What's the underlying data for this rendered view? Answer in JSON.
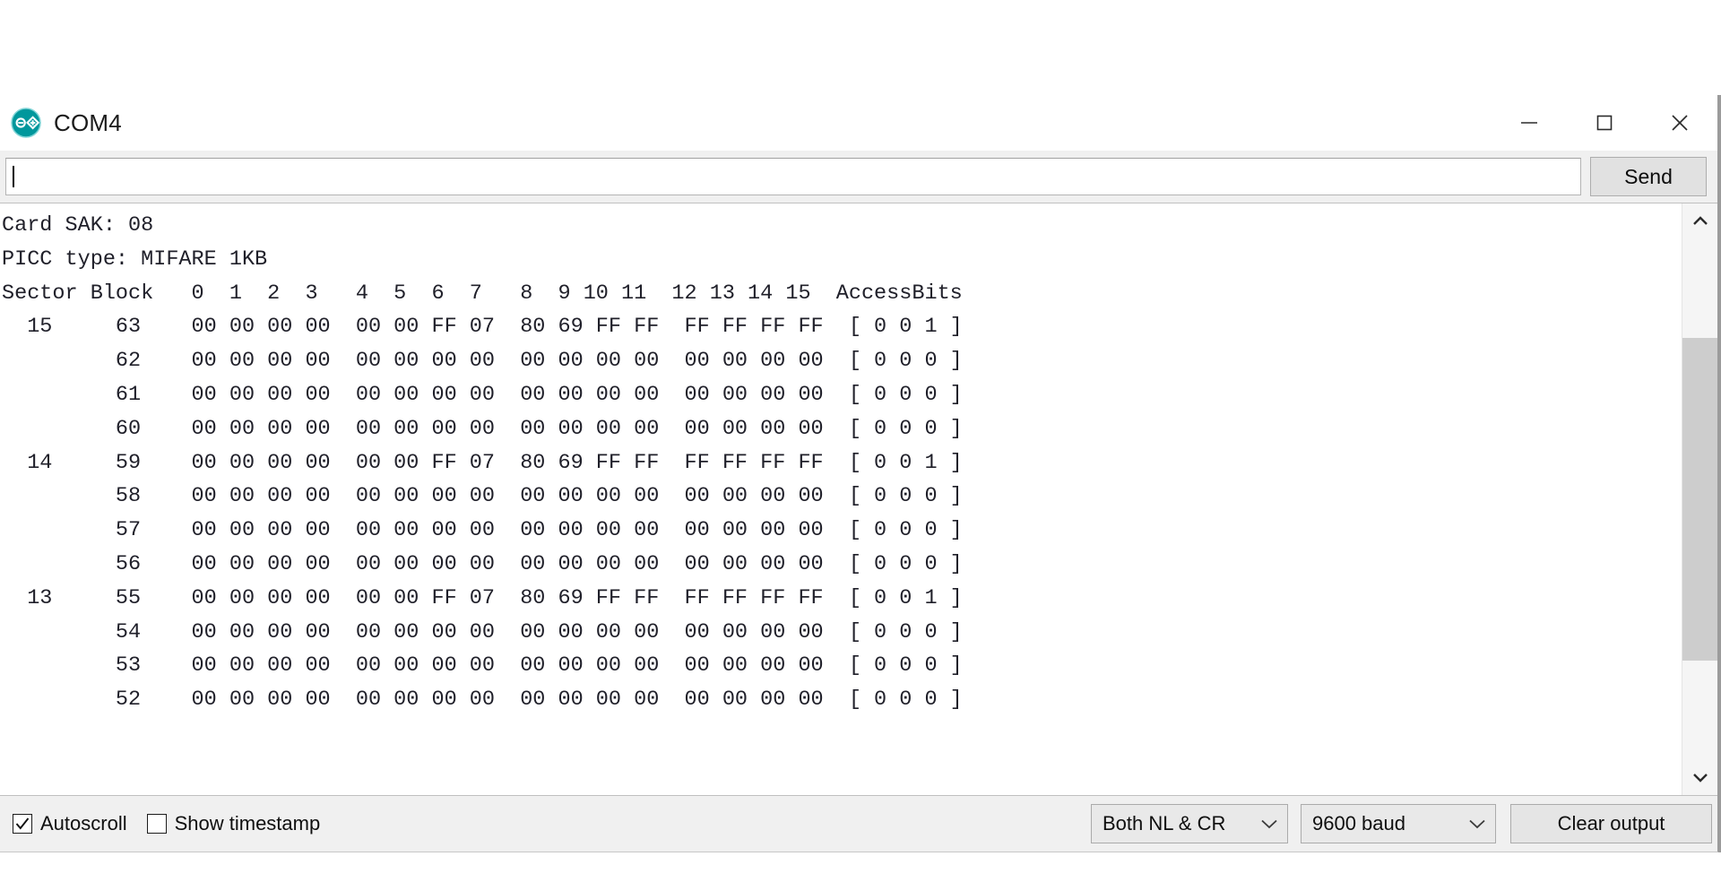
{
  "window": {
    "title": "COM4",
    "app_icon": "arduino-logo-icon",
    "controls": {
      "minimize": "minimize-icon",
      "maximize": "maximize-icon",
      "close": "close-icon"
    }
  },
  "send_bar": {
    "input_value": "",
    "input_placeholder": "",
    "send_label": "Send"
  },
  "output": {
    "lines": [
      "Card SAK: 08",
      "PICC type: MIFARE 1KB",
      "Sector Block   0  1  2  3   4  5  6  7   8  9 10 11  12 13 14 15  AccessBits",
      "  15     63    00 00 00 00  00 00 FF 07  80 69 FF FF  FF FF FF FF  [ 0 0 1 ]",
      "         62    00 00 00 00  00 00 00 00  00 00 00 00  00 00 00 00  [ 0 0 0 ]",
      "         61    00 00 00 00  00 00 00 00  00 00 00 00  00 00 00 00  [ 0 0 0 ]",
      "         60    00 00 00 00  00 00 00 00  00 00 00 00  00 00 00 00  [ 0 0 0 ]",
      "  14     59    00 00 00 00  00 00 FF 07  80 69 FF FF  FF FF FF FF  [ 0 0 1 ]",
      "         58    00 00 00 00  00 00 00 00  00 00 00 00  00 00 00 00  [ 0 0 0 ]",
      "         57    00 00 00 00  00 00 00 00  00 00 00 00  00 00 00 00  [ 0 0 0 ]",
      "         56    00 00 00 00  00 00 00 00  00 00 00 00  00 00 00 00  [ 0 0 0 ]",
      "  13     55    00 00 00 00  00 00 FF 07  80 69 FF FF  FF FF FF FF  [ 0 0 1 ]",
      "         54    00 00 00 00  00 00 00 00  00 00 00 00  00 00 00 00  [ 0 0 0 ]",
      "         53    00 00 00 00  00 00 00 00  00 00 00 00  00 00 00 00  [ 0 0 0 ]",
      "         52    00 00 00 00  00 00 00 00  00 00 00 00  00 00 00 00  [ 0 0 0 ]"
    ]
  },
  "scrollbar": {
    "up_arrow": "chevron-up-icon",
    "down_arrow": "chevron-down-icon",
    "thumb_top_pct": 19,
    "thumb_height_pct": 62
  },
  "status_bar": {
    "autoscroll": {
      "label": "Autoscroll",
      "checked": true,
      "check_glyph": "✓"
    },
    "show_timestamp": {
      "label": "Show timestamp",
      "checked": false,
      "check_glyph": ""
    },
    "line_ending": {
      "value": "Both NL & CR",
      "chevron": "chevron-down-icon"
    },
    "baud_rate": {
      "value": "9600 baud",
      "chevron": "chevron-down-icon"
    },
    "clear_output_label": "Clear output"
  },
  "colors": {
    "accent_teal": "#00979c",
    "window_chrome": "#f0f0f0",
    "output_bg": "#ffffff",
    "output_text": "#20202a",
    "scrollbar_thumb": "#cdcdcd",
    "border": "#ababab"
  }
}
